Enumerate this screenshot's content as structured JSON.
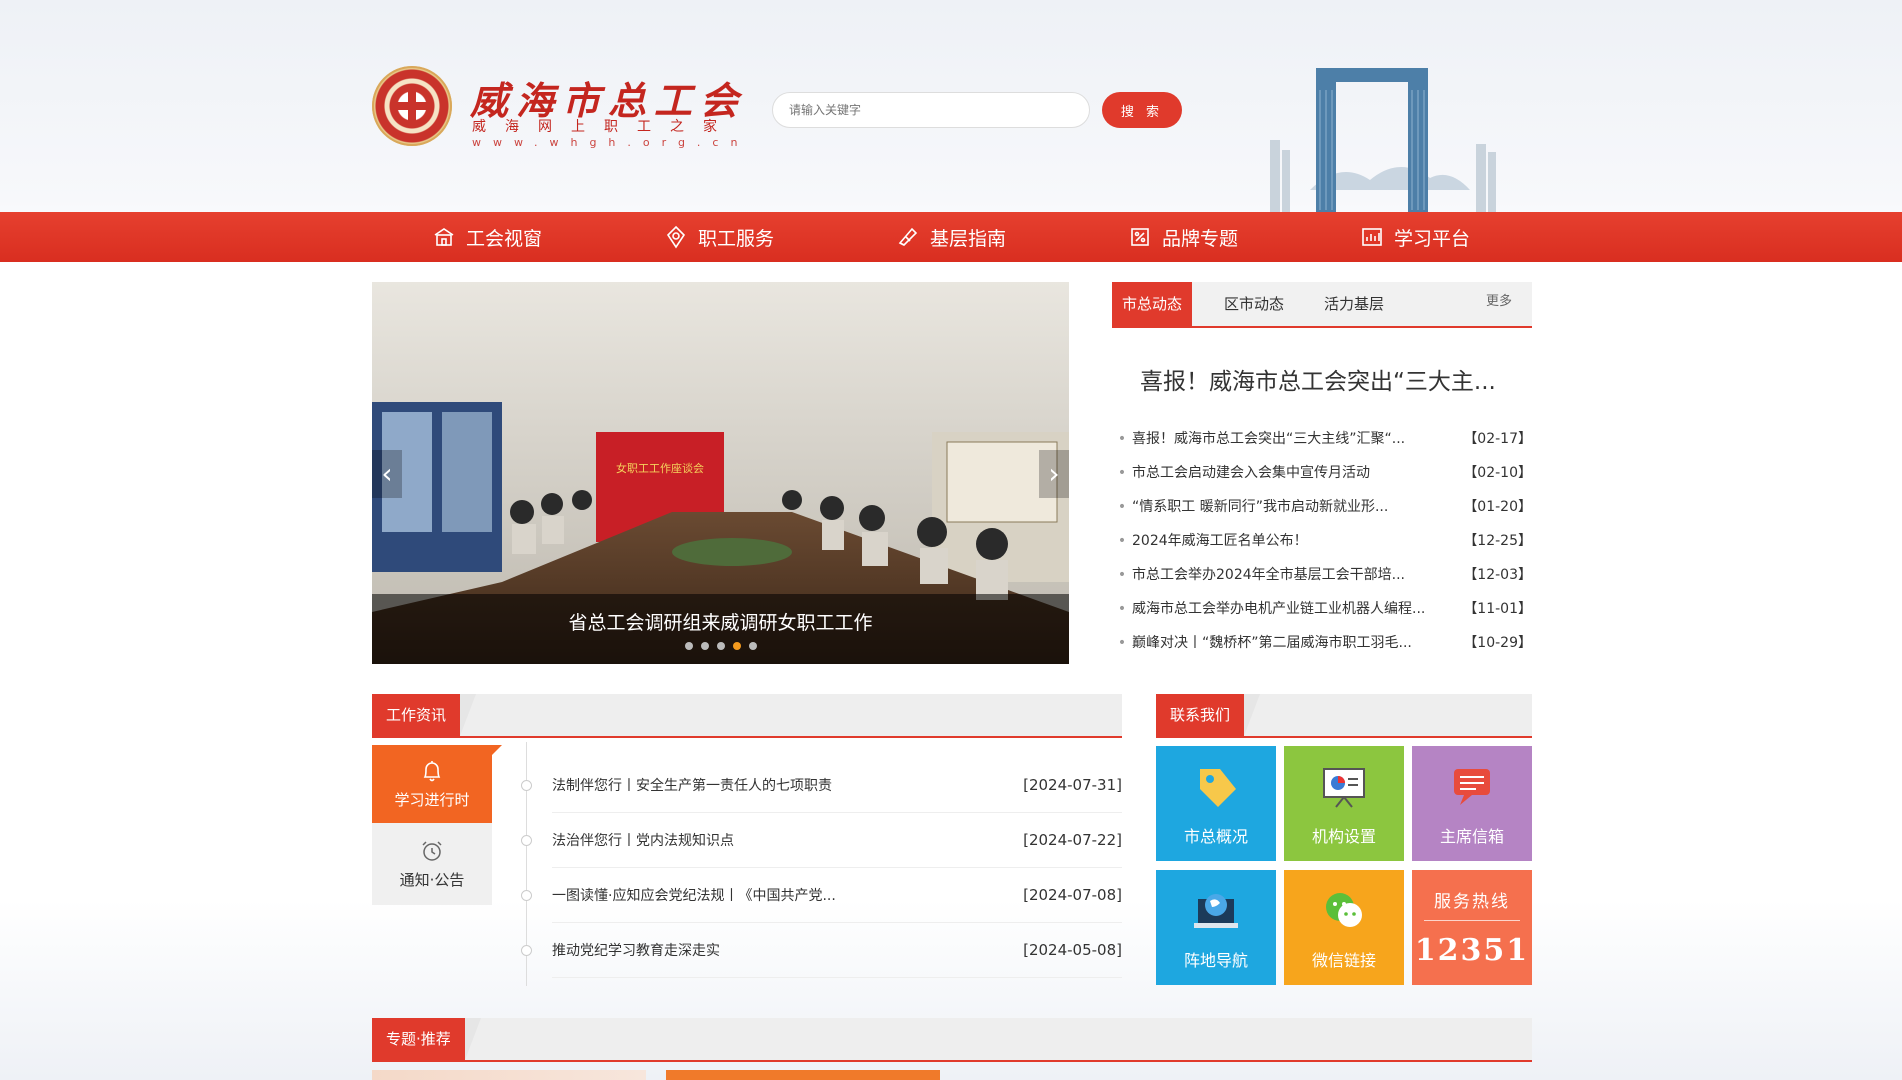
{
  "header": {
    "logo_title": "威海市总工会",
    "logo_subtitle": "威海网上职工之家",
    "logo_url": "www.whgh.org.cn",
    "search_placeholder": "请输入关键字",
    "search_button": "搜 索"
  },
  "nav": {
    "items": [
      {
        "label": "工会视窗",
        "icon": "building-icon"
      },
      {
        "label": "职工服务",
        "icon": "badge-icon"
      },
      {
        "label": "基层指南",
        "icon": "book-icon"
      },
      {
        "label": "品牌专题",
        "icon": "ticket-icon"
      },
      {
        "label": "学习平台",
        "icon": "chart-icon"
      }
    ]
  },
  "banner": {
    "caption": "省总工会调研组来威调研女职工工作",
    "sign_text": "女职工工作座谈会",
    "prev": "‹",
    "next": "›",
    "dot_count": 5,
    "active_dot": 3
  },
  "news": {
    "tabs": [
      "市总动态",
      "区市动态",
      "活力基层"
    ],
    "more": "更多",
    "headline": "喜报！威海市总工会突出“三大主...",
    "items": [
      {
        "title": "喜报！威海市总工会突出“三大主线”汇聚“...",
        "date": "【02-17】"
      },
      {
        "title": "市总工会启动建会入会集中宣传月活动",
        "date": "【02-10】"
      },
      {
        "title": "“情系职工 暖新同行”我市启动新就业形...",
        "date": "【01-20】"
      },
      {
        "title": "2024年威海工匠名单公布！",
        "date": "【12-25】"
      },
      {
        "title": "市总工会举办2024年全市基层工会干部培...",
        "date": "【12-03】"
      },
      {
        "title": "威海市总工会举办电机产业链工业机器人编程...",
        "date": "【11-01】"
      },
      {
        "title": "巅峰对决丨“魏桥杯”第二届威海市职工羽毛...",
        "date": "【10-29】"
      }
    ]
  },
  "work": {
    "section_title": "工作资讯",
    "side": [
      {
        "label": "学习进行时",
        "icon": "bell-icon"
      },
      {
        "label": "通知·公告",
        "icon": "alarm-clock-icon"
      }
    ],
    "items": [
      {
        "title": "法制伴您行丨安全生产第一责任人的七项职责",
        "date": "[2024-07-31]"
      },
      {
        "title": "法治伴您行丨党内法规知识点",
        "date": "[2024-07-22]"
      },
      {
        "title": "一图读懂·应知应会党纪法规丨《中国共产党...",
        "date": "[2024-07-08]"
      },
      {
        "title": "推动党纪学习教育走深走实",
        "date": "[2024-05-08]"
      }
    ]
  },
  "contact": {
    "section_title": "联系我们",
    "tiles": [
      {
        "label": "市总概况",
        "icon": "tag-icon",
        "color": "#1ea7e0"
      },
      {
        "label": "机构设置",
        "icon": "presentation-icon",
        "color": "#8cc63f"
      },
      {
        "label": "主席信箱",
        "icon": "chat-icon",
        "color": "#b584c4"
      },
      {
        "label": "阵地导航",
        "icon": "globe-laptop-icon",
        "color": "#1ea7e0"
      },
      {
        "label": "微信链接",
        "icon": "wechat-icon",
        "color": "#f7a51c"
      }
    ],
    "hotline_label": "服务热线",
    "hotline_number": "12351",
    "hotline_color": "#f5704e"
  },
  "topics": {
    "section_title": "专题·推荐"
  },
  "colors": {
    "brand_red": "#e03a2c",
    "accent_orange": "#f26522"
  }
}
